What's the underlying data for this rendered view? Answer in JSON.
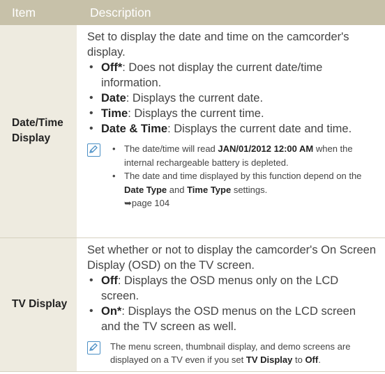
{
  "header": {
    "item": "Item",
    "description": "Description"
  },
  "rows": [
    {
      "item_line1": "Date/Time",
      "item_line2": "Display",
      "intro": "Set to display the date and time on the camcorder's display.",
      "options": [
        {
          "term": "Off*",
          "text": ": Does not display the current date/time information."
        },
        {
          "term": "Date",
          "text": ": Displays the current date."
        },
        {
          "term": "Time",
          "text": ": Displays the current time."
        },
        {
          "term": "Date & Time",
          "text": ": Displays the current date and time."
        }
      ],
      "notes": [
        {
          "a": "The date/time will read ",
          "b": "JAN/01/2012 12:00 AM",
          "c": " when the internal rechargeable battery is depleted."
        },
        {
          "a": "The date and time displayed by this function depend on the ",
          "b": "Date Type",
          "c": " and ",
          "d": "Time Type",
          "e": " settings.",
          "f": "➥page 104"
        }
      ]
    },
    {
      "item_line1": "TV Display",
      "intro": "Set whether or not to display the camcorder's On Screen Display (OSD) on the TV screen.",
      "options": [
        {
          "term": "Off",
          "text": ": Displays the OSD menus only on the LCD screen."
        },
        {
          "term": "On*",
          "text": ": Displays the OSD menus on the LCD screen and the TV screen as well."
        }
      ],
      "note": {
        "a": "The menu screen, thumbnail display, and demo screens are displayed on a TV even if you set ",
        "b": "TV Display",
        "c": " to ",
        "d": "Off",
        "e": "."
      }
    }
  ],
  "icons": {
    "note": "note-pencil-icon",
    "accent": "#4a8fc5"
  },
  "colors": {
    "header_bg": "#c7c1a9",
    "item_bg": "#eeebe0",
    "border": "#d6d1bf"
  }
}
